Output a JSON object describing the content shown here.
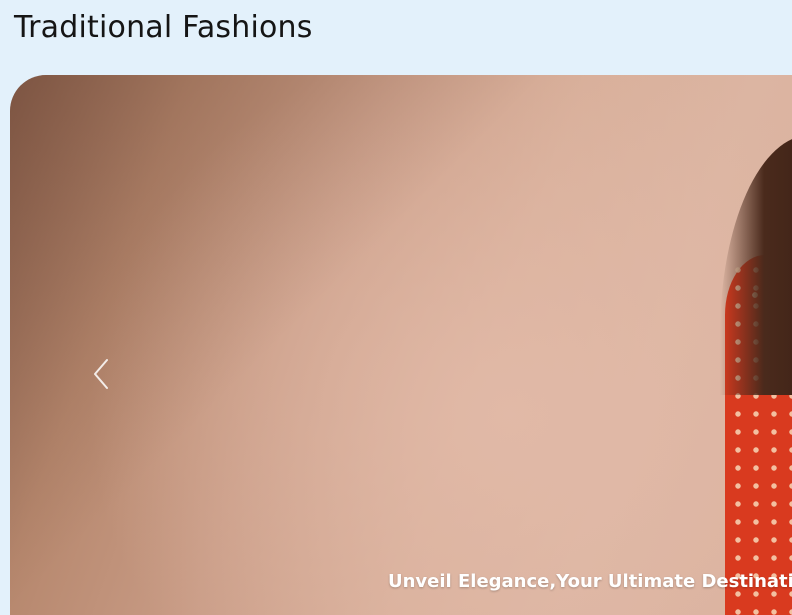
{
  "header": {
    "brand": "Traditional Fashions"
  },
  "carousel": {
    "prev_icon": "chevron-left-icon",
    "caption": "Unveil Elegance,Your Ultimate Destination fo",
    "image_alt": "Model in red floral dress"
  }
}
